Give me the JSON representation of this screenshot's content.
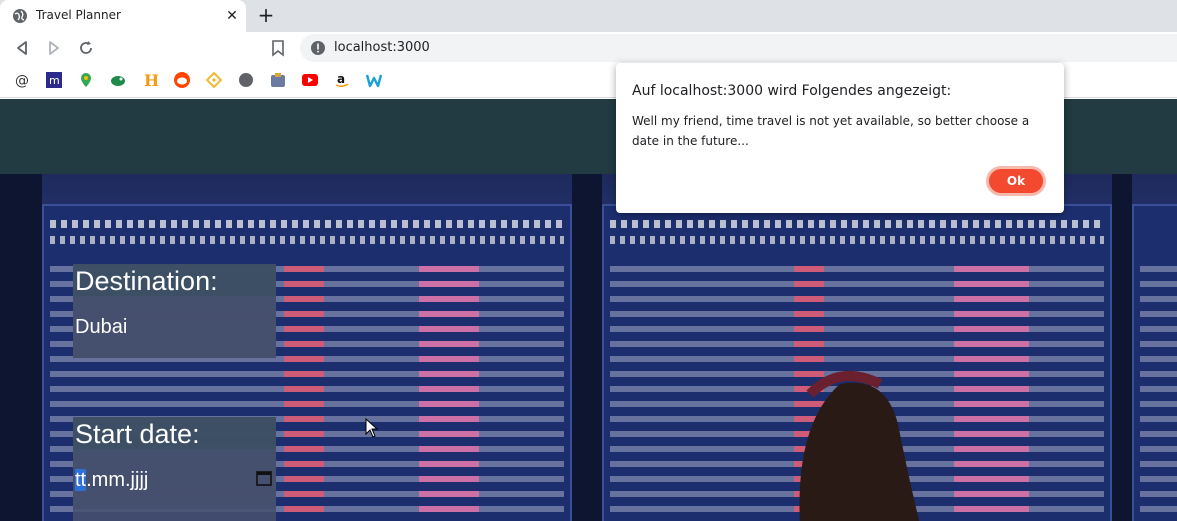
{
  "browser": {
    "tab_title": "Travel Planner",
    "new_tab_label": "+",
    "url": "localhost:3000"
  },
  "form": {
    "destination_label": "Destination:",
    "destination_value": "Dubai",
    "start_label": "Start date:",
    "date_placeholder_sel": "tt",
    "date_placeholder_rest": ".mm.jjjj"
  },
  "dialog": {
    "title": "Auf localhost:3000 wird Folgendes angezeigt:",
    "message": "Well my friend, time travel is not yet available, so better choose a date in the future...",
    "ok_label": "Ok"
  },
  "colors": {
    "header": "#223a42",
    "ok_button": "#f2492f"
  }
}
